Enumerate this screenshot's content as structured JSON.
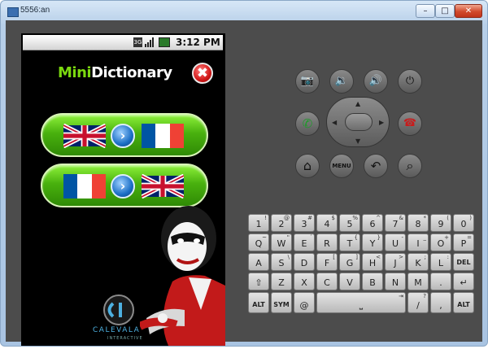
{
  "window": {
    "title": "5556:an",
    "min_glyph": "–",
    "max_glyph": "□",
    "close_glyph": "✕"
  },
  "status_bar": {
    "network": "3G",
    "time": "3:12 PM"
  },
  "app": {
    "title_part1": "Mini",
    "title_part2": "Dictionary",
    "close_glyph": "✖",
    "buttons": [
      {
        "from": "English",
        "to": "French"
      },
      {
        "from": "French",
        "to": "English"
      }
    ],
    "arrow_glyph": "›",
    "logo_text": "CALEVALA",
    "logo_sub": "INTERACTIVE"
  },
  "hardware_buttons": {
    "camera": "📷",
    "volume_down": "🔉",
    "volume_up": "🔊",
    "power": "⏻",
    "call": "✆",
    "end_call": "☎",
    "home": "⌂",
    "menu": "MENU",
    "back": "↶",
    "search": "⌕"
  },
  "keyboard": {
    "row1": [
      {
        "main": "1",
        "alt": "!"
      },
      {
        "main": "2",
        "alt": "@"
      },
      {
        "main": "3",
        "alt": "#"
      },
      {
        "main": "4",
        "alt": "$"
      },
      {
        "main": "5",
        "alt": "%"
      },
      {
        "main": "6",
        "alt": "^"
      },
      {
        "main": "7",
        "alt": "&"
      },
      {
        "main": "8",
        "alt": "*"
      },
      {
        "main": "9",
        "alt": "("
      },
      {
        "main": "0",
        "alt": ")"
      }
    ],
    "row2": [
      {
        "main": "Q",
        "alt": "~"
      },
      {
        "main": "W",
        "alt": "\""
      },
      {
        "main": "E",
        "alt": "´"
      },
      {
        "main": "R",
        "alt": ""
      },
      {
        "main": "T",
        "alt": "{"
      },
      {
        "main": "Y",
        "alt": "}"
      },
      {
        "main": "U",
        "alt": "-"
      },
      {
        "main": "I",
        "alt": "_"
      },
      {
        "main": "O",
        "alt": "+"
      },
      {
        "main": "P",
        "alt": "="
      }
    ],
    "row3": [
      {
        "main": "A",
        "alt": ""
      },
      {
        "main": "S",
        "alt": "\\"
      },
      {
        "main": "D",
        "alt": ""
      },
      {
        "main": "F",
        "alt": "["
      },
      {
        "main": "G",
        "alt": "]"
      },
      {
        "main": "H",
        "alt": "<"
      },
      {
        "main": "J",
        "alt": ">"
      },
      {
        "main": "K",
        "alt": ";"
      },
      {
        "main": "L",
        "alt": ":"
      },
      {
        "main": "DEL",
        "alt": ""
      }
    ],
    "row4": [
      {
        "main": "⇧",
        "alt": ""
      },
      {
        "main": "Z",
        "alt": ""
      },
      {
        "main": "X",
        "alt": ""
      },
      {
        "main": "C",
        "alt": ""
      },
      {
        "main": "V",
        "alt": ""
      },
      {
        "main": "B",
        "alt": ""
      },
      {
        "main": "N",
        "alt": ""
      },
      {
        "main": "M",
        "alt": ""
      },
      {
        "main": ".",
        "alt": ""
      },
      {
        "main": "↵",
        "alt": ""
      }
    ],
    "row5": [
      {
        "main": "ALT",
        "alt": ""
      },
      {
        "main": "SYM",
        "alt": ""
      },
      {
        "main": "@",
        "alt": ""
      },
      {
        "main": "⎵",
        "alt": "⇥"
      },
      {
        "main": "/",
        "alt": "?"
      },
      {
        "main": ",",
        "alt": ""
      },
      {
        "main": "ALT",
        "alt": ""
      }
    ]
  }
}
